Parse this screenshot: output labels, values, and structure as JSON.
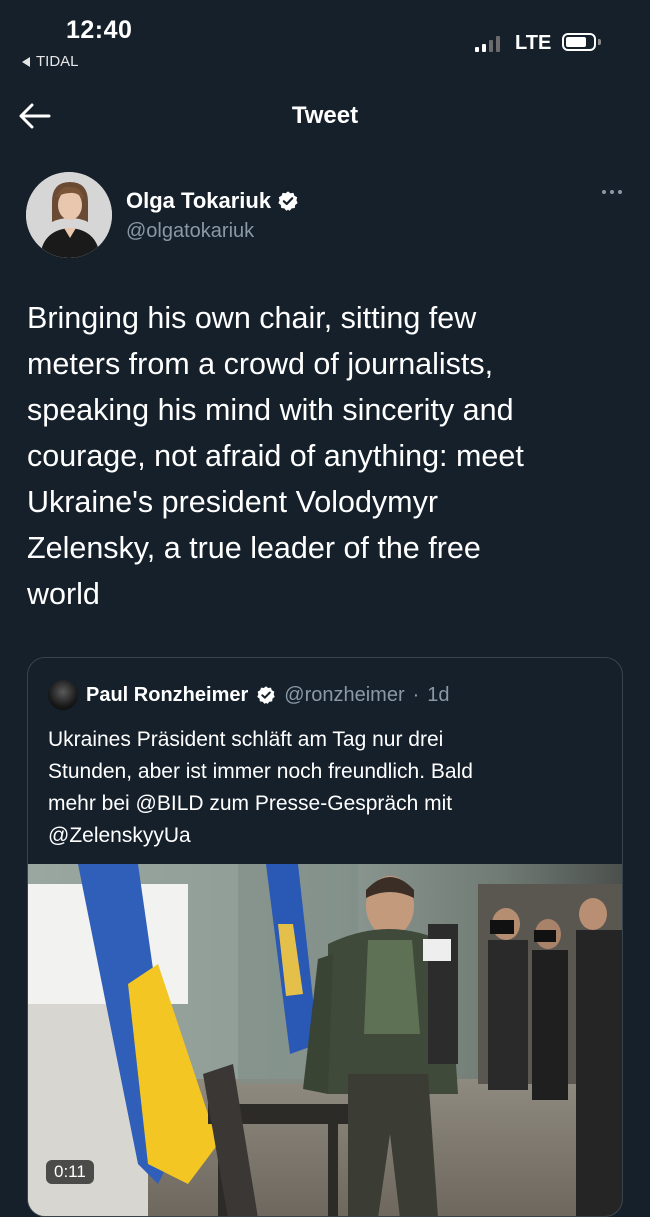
{
  "status_bar": {
    "time": "12:40",
    "back_app": "TIDAL",
    "network": "LTE",
    "signal_bars_active": 2,
    "signal_bars_total": 4,
    "battery_level": 0.75
  },
  "header": {
    "back_icon": "arrow-left-icon",
    "title": "Tweet"
  },
  "tweet": {
    "author": {
      "name": "Olga Tokariuk",
      "handle": "@olgatokariuk",
      "verified": true
    },
    "more_icon": "more-horizontal-icon",
    "text": "Bringing his own chair, sitting few\nmeters from a crowd of journalists,\nspeaking his mind with sincerity and\ncourage, not afraid of anything: meet\nUkraine's president Volodymyr\nZelensky, a true leader of the free\nworld"
  },
  "quoted_tweet": {
    "author": {
      "name": "Paul Ronzheimer",
      "handle": "@ronzheimer",
      "separator": "·",
      "time": "1d",
      "verified": true
    },
    "text": "Ukraines Präsident schläft am Tag nur drei\nStunden, aber ist immer noch freundlich. Bald\nmehr bei @BILD zum Presse-Gespräch mit\n@ZelenskyyUa",
    "video": {
      "duration": "0:11"
    }
  },
  "colors": {
    "background": "#15202b",
    "text_primary": "#ffffff",
    "text_secondary": "#8b98a5",
    "border": "#38444d",
    "verified_badge": "#ffffff"
  }
}
